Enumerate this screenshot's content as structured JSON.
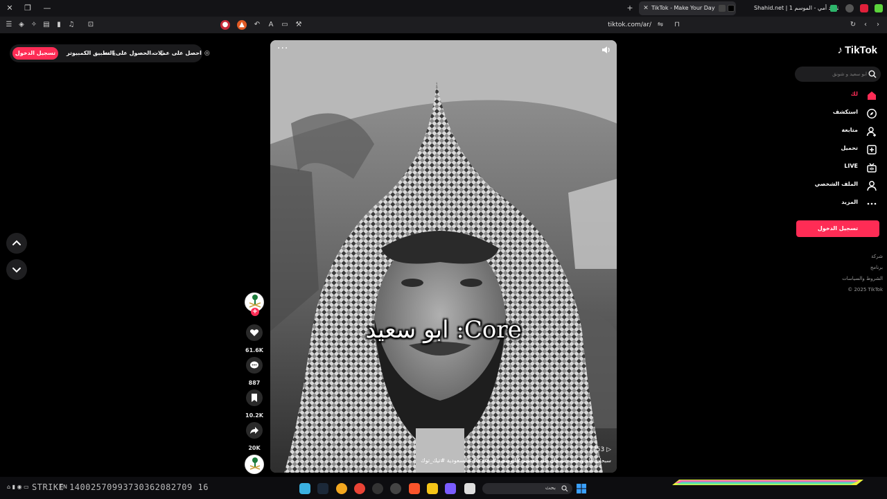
{
  "browser": {
    "tabs": [
      {
        "title": "TikTok - Make Your Day",
        "active": true
      },
      {
        "title": "Shahid.net | شاهد أمي - الموسم 1",
        "active": false
      }
    ],
    "url": "tiktok.com/ar/"
  },
  "topbar": {
    "login_label": "تسجيل الدخول",
    "pc_app_label": "تطبيق الكمبيوتر",
    "get_on_label": "الحصول على الت...",
    "coins_label": "احصل على عملات"
  },
  "sidebar": {
    "logo": "TikTok",
    "search_placeholder": "ابو سعيد و شونق",
    "nav": [
      {
        "label": "لك",
        "icon": "home-icon",
        "active": true
      },
      {
        "label": "استكشف",
        "icon": "compass-icon",
        "active": false
      },
      {
        "label": "متابعة",
        "icon": "following-icon",
        "active": false
      },
      {
        "label": "تحميل",
        "icon": "upload-icon",
        "active": false
      },
      {
        "label": "LIVE",
        "icon": "live-icon",
        "active": false
      },
      {
        "label": "الملف الشخصي",
        "icon": "profile-icon",
        "active": false
      },
      {
        "label": "المزيد",
        "icon": "more-icon",
        "active": false
      }
    ],
    "login_button": "تسجيل الدخول",
    "footer": [
      "شركة",
      "برنامج",
      "الشروط والسياسات",
      "© 2025 TikTok"
    ]
  },
  "video": {
    "overlay_title": "ابو سعيد :Core",
    "views": "7753 ▷",
    "caption": "سبحان الله وبحمده سبحان الله العظيم #ابوسعيد #foryou #السعودية #تيك_توك",
    "grayscale": true
  },
  "actions": {
    "likes": "61.6K",
    "comments": "887",
    "saves": "10.2K",
    "shares": "20K"
  },
  "taskbar": {
    "left_text": "EN",
    "strike_text": "STRIKE  14002570993730362082709 16",
    "search_label": "بحث"
  },
  "colors": {
    "accent": "#fe2c55",
    "background": "#000000",
    "panel": "#1b1b1d"
  }
}
